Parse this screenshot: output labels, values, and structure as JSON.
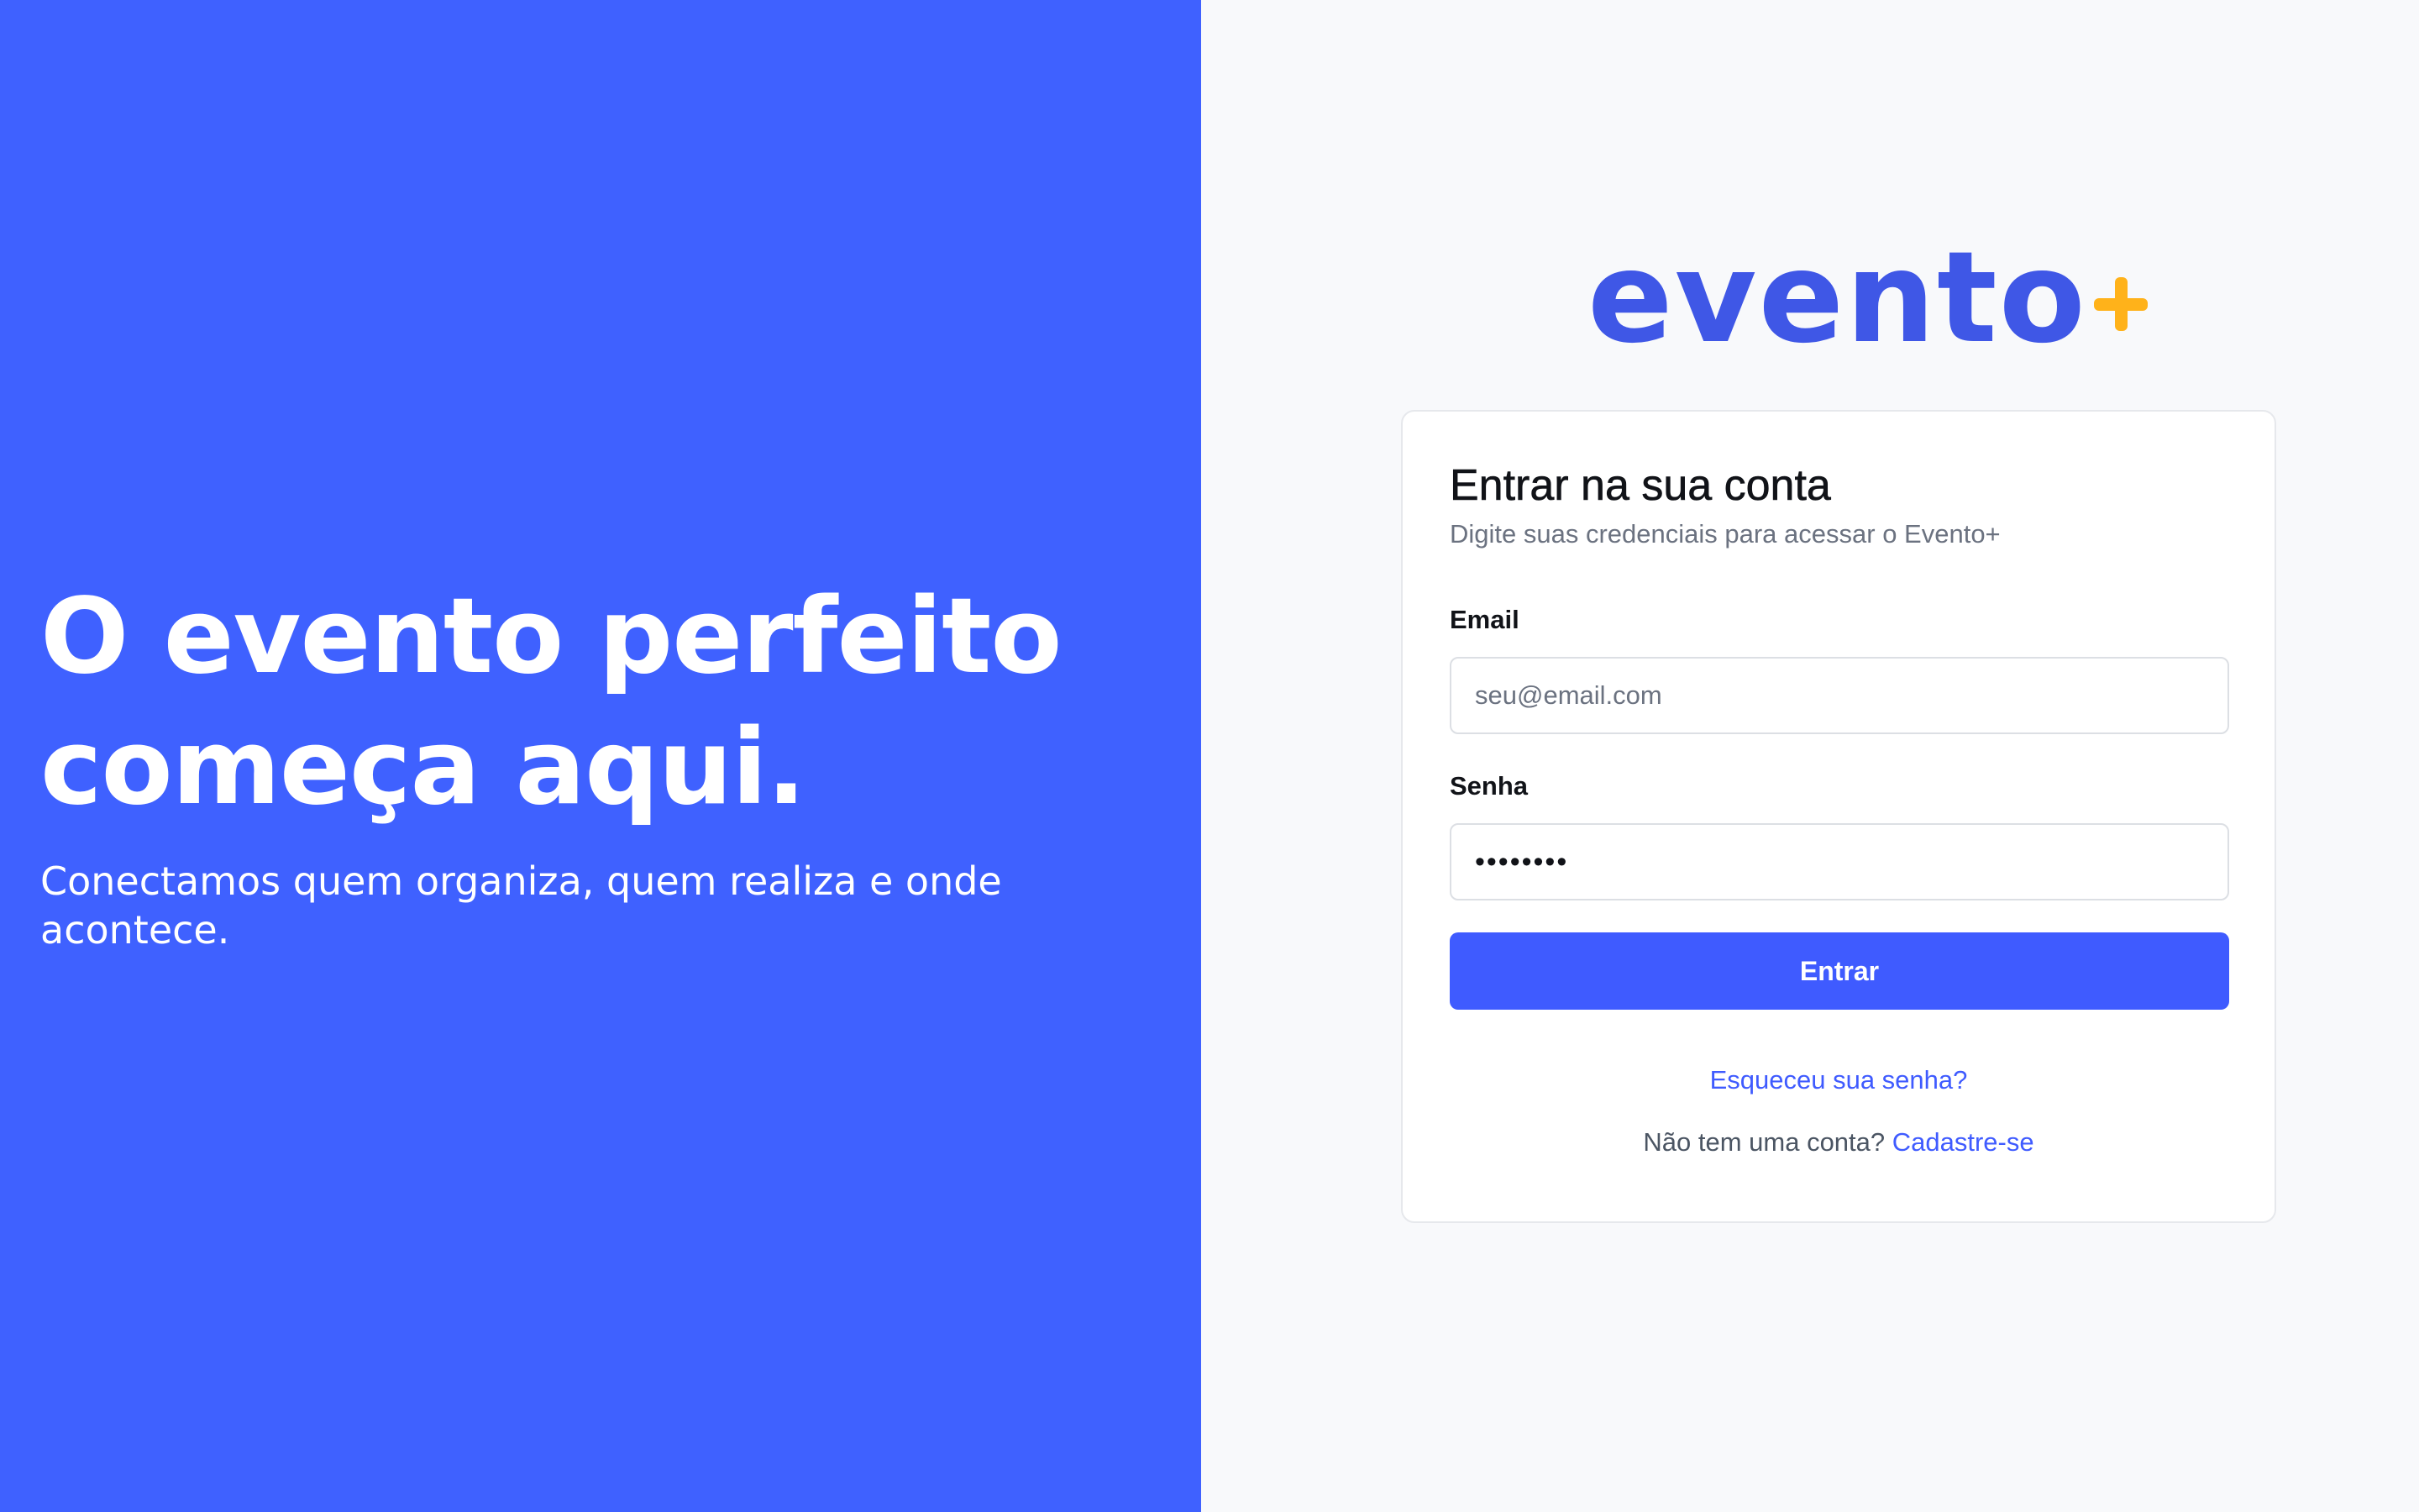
{
  "hero": {
    "title_line1": "O evento perfeito",
    "title_line2": "começa aqui.",
    "subtitle": "Conectamos quem organiza, quem realiza e onde acontece."
  },
  "brand": {
    "logo_text": "evento",
    "logo_symbol_icon": "plus-icon",
    "primary_color": "#3f5bff",
    "accent_color": "#ffb21a"
  },
  "login": {
    "title": "Entrar na sua conta",
    "description": "Digite suas credenciais para acessar o Evento+",
    "email": {
      "label": "Email",
      "placeholder": "seu@email.com",
      "value": ""
    },
    "password": {
      "label": "Senha",
      "value": "••••••••"
    },
    "submit_label": "Entrar",
    "forgot_password_label": "Esqueceu sua senha?",
    "signup_prompt": "Não tem uma conta? ",
    "signup_label": "Cadastre-se"
  }
}
